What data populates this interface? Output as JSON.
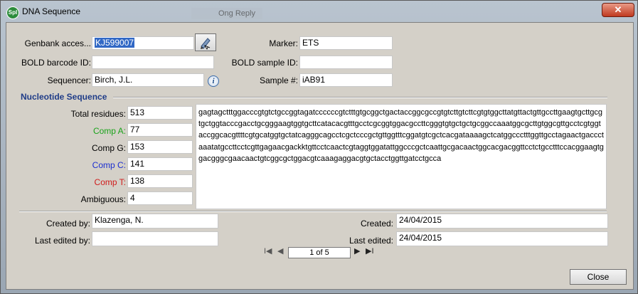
{
  "window": {
    "title": "DNA Sequence",
    "app_icon": "SpI",
    "background_tab": "Ong Reply",
    "close_glyph": "✕"
  },
  "fields": {
    "genbank": {
      "label": "Genbank acces...",
      "value": "KJ599007"
    },
    "marker": {
      "label": "Marker:",
      "value": "ETS"
    },
    "bold_barcode": {
      "label": "BOLD barcode ID:",
      "value": ""
    },
    "bold_sample": {
      "label": "BOLD sample ID:",
      "value": ""
    },
    "sequencer": {
      "label": "Sequencer:",
      "value": "Birch, J.L."
    },
    "sample_no": {
      "label": "Sample #:",
      "value": "iAB91"
    }
  },
  "nucleotide": {
    "section_title": "Nucleotide Sequence",
    "stats": [
      {
        "label": "Total residues:",
        "value": "513",
        "color": "#000000"
      },
      {
        "label": "Comp A:",
        "value": "77",
        "color": "#1aa31a"
      },
      {
        "label": "Comp G:",
        "value": "153",
        "color": "#000000"
      },
      {
        "label": "Comp C:",
        "value": "141",
        "color": "#1c2fd0"
      },
      {
        "label": "Comp T:",
        "value": "138",
        "color": "#d01c1c"
      },
      {
        "label": "Ambiguous:",
        "value": "4",
        "color": "#000000"
      }
    ],
    "sequence": "gagtagctttggacccgtgtctgccggtagatccccccgtctttgtgcggctgactaccggcgccgtgtcttgtcttcgtgtggcttatgttactgttgccttgaagtgcttgcgtgctggtacccgacctgcgggaagtggtgcttcatacacgtttgcctcgcggtggacgccttcgggtgtgctgctgcggccaaatggcgcttgtggcgttgcctcgtggtaccggcacgttttcgtgcatggtgctatcagggcagcctcgctcccgctgttggtttcggatgtcgctcacgataaaagctcatggccctttggttgcctagaactgaccctaaatatgccttcctcgttgagaacgackktgttcctcaactcgtaggtggatattggcccgctcaattgcgacaactggcacgacggttcctctgcctttccacggaagtggacgggcgaacaactgtcggcgctggacgtcaaagaggacgtgctacctggttgatcctgcca"
  },
  "footer": {
    "created_by": {
      "label": "Created by:",
      "value": "Klazenga, N."
    },
    "last_edited_by": {
      "label": "Last edited by:",
      "value": ""
    },
    "created": {
      "label": "Created:",
      "value": "24/04/2015"
    },
    "last_edited": {
      "label": "Last edited:",
      "value": "24/04/2015"
    },
    "pager": {
      "first": "I◀",
      "prev": "◀",
      "text": "1 of 5",
      "next": "▶",
      "last": "▶I"
    },
    "close_label": "Close"
  }
}
